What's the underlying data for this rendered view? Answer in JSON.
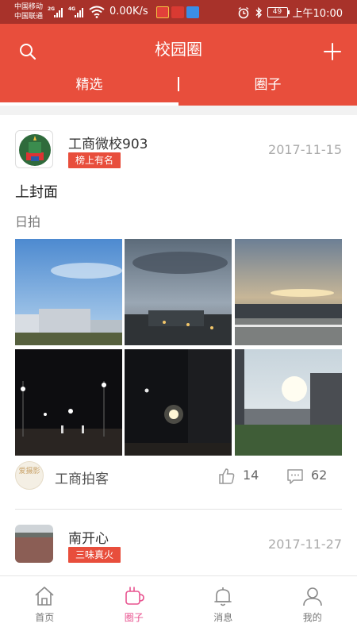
{
  "status_bar": {
    "carrier1": "中国移动",
    "carrier2": "中国联通",
    "net1": "2G",
    "net2": "4G",
    "speed": "0.00K/s",
    "battery": "49",
    "time": "上午10:00"
  },
  "header": {
    "title": "校园圈",
    "search_icon": "search-icon",
    "add_icon": "plus-icon",
    "tabs": [
      {
        "label": "精选",
        "active": true
      },
      {
        "label": "圈子",
        "active": false
      }
    ]
  },
  "posts": [
    {
      "author": "工商微校903",
      "badge": "榜上有名",
      "date": "2017-11-15",
      "title": "上封面",
      "subtitle": "日拍",
      "photos": [
        "sky-over-campus-buildings",
        "dusk-clouds-over-lit-buildings",
        "sunset-over-sports-field",
        "night-basketball-court",
        "moon-over-street-lamp-at-night",
        "sun-between-buildings"
      ],
      "source": {
        "avatar_text": "爱摄影",
        "name": "工商拍客"
      },
      "likes": "14",
      "comments": "62"
    },
    {
      "author": "南开心",
      "badge": "三味真火",
      "date": "2017-11-27"
    }
  ],
  "bottom_nav": [
    {
      "label": "首页",
      "icon": "home-icon",
      "active": false
    },
    {
      "label": "圈子",
      "icon": "circle-cup-icon",
      "active": true
    },
    {
      "label": "消息",
      "icon": "bell-icon",
      "active": false
    },
    {
      "label": "我的",
      "icon": "user-icon",
      "active": false
    }
  ],
  "colors": {
    "status_bar": "#a8322a",
    "header": "#e84e3c",
    "badge": "#e84e3c",
    "nav_active": "#e8538f"
  }
}
